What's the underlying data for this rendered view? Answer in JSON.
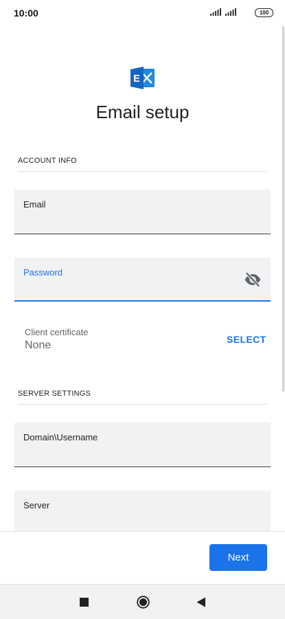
{
  "status_bar": {
    "time": "10:00",
    "battery": "100"
  },
  "app": {
    "logo_icon": "exchange-icon",
    "title": "Email setup"
  },
  "account_info": {
    "header": "ACCOUNT INFO",
    "email": {
      "label": "Email",
      "value": ""
    },
    "password": {
      "label": "Password",
      "value": "",
      "visibility_icon": "eye-off-icon"
    },
    "client_certificate": {
      "label": "Client certificate",
      "value": "None",
      "select_label": "SELECT"
    }
  },
  "server_settings": {
    "header": "SERVER SETTINGS",
    "domain_username": {
      "label": "Domain\\Username",
      "value": ""
    },
    "server": {
      "label": "Server",
      "value": ""
    }
  },
  "footer": {
    "next_label": "Next"
  },
  "nav_bar": {
    "recents_icon": "square-icon",
    "home_icon": "circle-icon",
    "back_icon": "triangle-back-icon"
  },
  "colors": {
    "accent": "#1a73e8",
    "field_bg": "#f1f2f3",
    "logo_blue": "#1565c0"
  }
}
